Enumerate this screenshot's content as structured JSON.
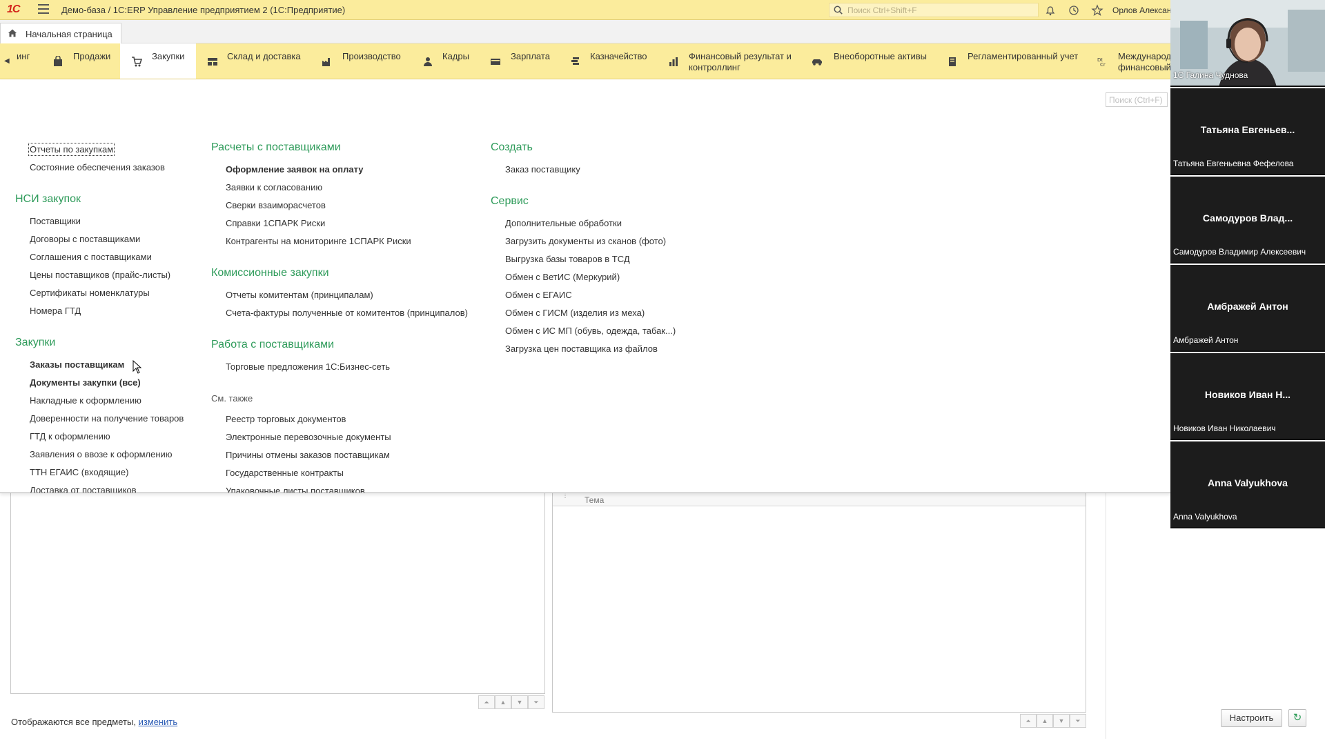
{
  "window": {
    "title": "Демо-база / 1С:ERP Управление предприятием 2  (1С:Предприятие)",
    "logo": "1С",
    "search_placeholder": "Поиск Ctrl+Shift+F",
    "user": "Орлов Александ"
  },
  "tabs": {
    "home": "Начальная страница"
  },
  "sections": [
    {
      "label": "инг",
      "icon": "partial-icon"
    },
    {
      "label": "Продажи",
      "icon": "bag-icon"
    },
    {
      "label": "Закупки",
      "icon": "cart-icon",
      "active": true
    },
    {
      "label": "Склад и доставка",
      "icon": "warehouse-icon"
    },
    {
      "label": "Производство",
      "icon": "factory-icon"
    },
    {
      "label": "Кадры",
      "icon": "person-icon"
    },
    {
      "label": "Зарплата",
      "icon": "wallet-icon"
    },
    {
      "label": "Казначейство",
      "icon": "coins-icon"
    },
    {
      "label": "Финансовый результат и\nконтроллинг",
      "icon": "chart-icon"
    },
    {
      "label": "Внеоборотные активы",
      "icon": "car-icon"
    },
    {
      "label": "Регламентированный учет",
      "icon": "book-icon"
    },
    {
      "label": "Международ\nфинансовый",
      "icon": "dtcr-icon"
    }
  ],
  "panel": {
    "search_placeholder": "Поиск (Ctrl+F)",
    "col1": {
      "top_items": [
        "Отчеты по закупкам",
        "Состояние обеспечения заказов"
      ],
      "nsi_title": "НСИ закупок",
      "nsi_items": [
        "Поставщики",
        "Договоры с поставщиками",
        "Соглашения с поставщиками",
        "Цены поставщиков (прайс-листы)",
        "Сертификаты номенклатуры",
        "Номера ГТД"
      ],
      "purchases_title": "Закупки",
      "purchases_items": [
        "Заказы поставщикам",
        "Документы закупки (все)",
        "Накладные к оформлению",
        "Доверенности на получение товаров",
        "ГТД к оформлению",
        "Заявления о ввозе к оформлению",
        "ТТН ЕГАИС (входящие)",
        "Доставка от поставщиков"
      ]
    },
    "col2": {
      "settlements_title": "Расчеты с поставщиками",
      "settlements_items": [
        "Оформление заявок на оплату",
        "Заявки к согласованию",
        "Сверки взаиморасчетов",
        "Справки 1СПАРК Риски",
        "Контрагенты на мониторинге 1СПАРК Риски"
      ],
      "commission_title": "Комиссионные закупки",
      "commission_items": [
        "Отчеты комитентам (принципалам)",
        "Счета-фактуры полученные от комитентов (принципалов)"
      ],
      "work_title": "Работа с поставщиками",
      "work_items": [
        "Торговые предложения 1С:Бизнес-сеть"
      ],
      "see_also_title": "См. также",
      "see_also_items": [
        "Реестр торговых документов",
        "Электронные перевозочные документы",
        "Причины отмены заказов поставщикам",
        "Государственные контракты",
        "Упаковочные листы поставщиков"
      ]
    },
    "col3": {
      "create_title": "Создать",
      "create_items": [
        "Заказ поставщику"
      ],
      "service_title": "Сервис",
      "service_items": [
        "Дополнительные обработки",
        "Загрузить документы из сканов (фото)",
        "Выгрузка базы товаров в ТСД",
        "Обмен с ВетИС (Меркурий)",
        "Обмен с ЕГАИС",
        "Обмен с ГИСМ (изделия из меха)",
        "Обмен с ИС МП (обувь, одежда, табак...)",
        "Загрузка цен поставщика из файлов"
      ]
    }
  },
  "form": {
    "table_header": "Тема",
    "subjects_note": "Отображаются все предметы,",
    "subjects_link": "изменить",
    "configure_button": "Настроить"
  },
  "call": {
    "participants": [
      {
        "short": "",
        "full": "1С Галина Чуднова",
        "video": true
      },
      {
        "short": "Татьяна Евгеньев...",
        "full": "Татьяна Евгеньевна Фефелова"
      },
      {
        "short": "Самодуров Влад...",
        "full": "Самодуров Владимир Алексеевич"
      },
      {
        "short": "Амбражей Антон",
        "full": "Амбражей Антон"
      },
      {
        "short": "Новиков Иван Н...",
        "full": "Новиков Иван Николаевич"
      },
      {
        "short": "Anna Valyukhova",
        "full": "Anna Valyukhova"
      }
    ]
  },
  "colors": {
    "accent_yellow": "#fbec9c",
    "group_green": "#2e9b5a",
    "link_blue": "#2a5bb5",
    "logo_red": "#d3251b"
  }
}
